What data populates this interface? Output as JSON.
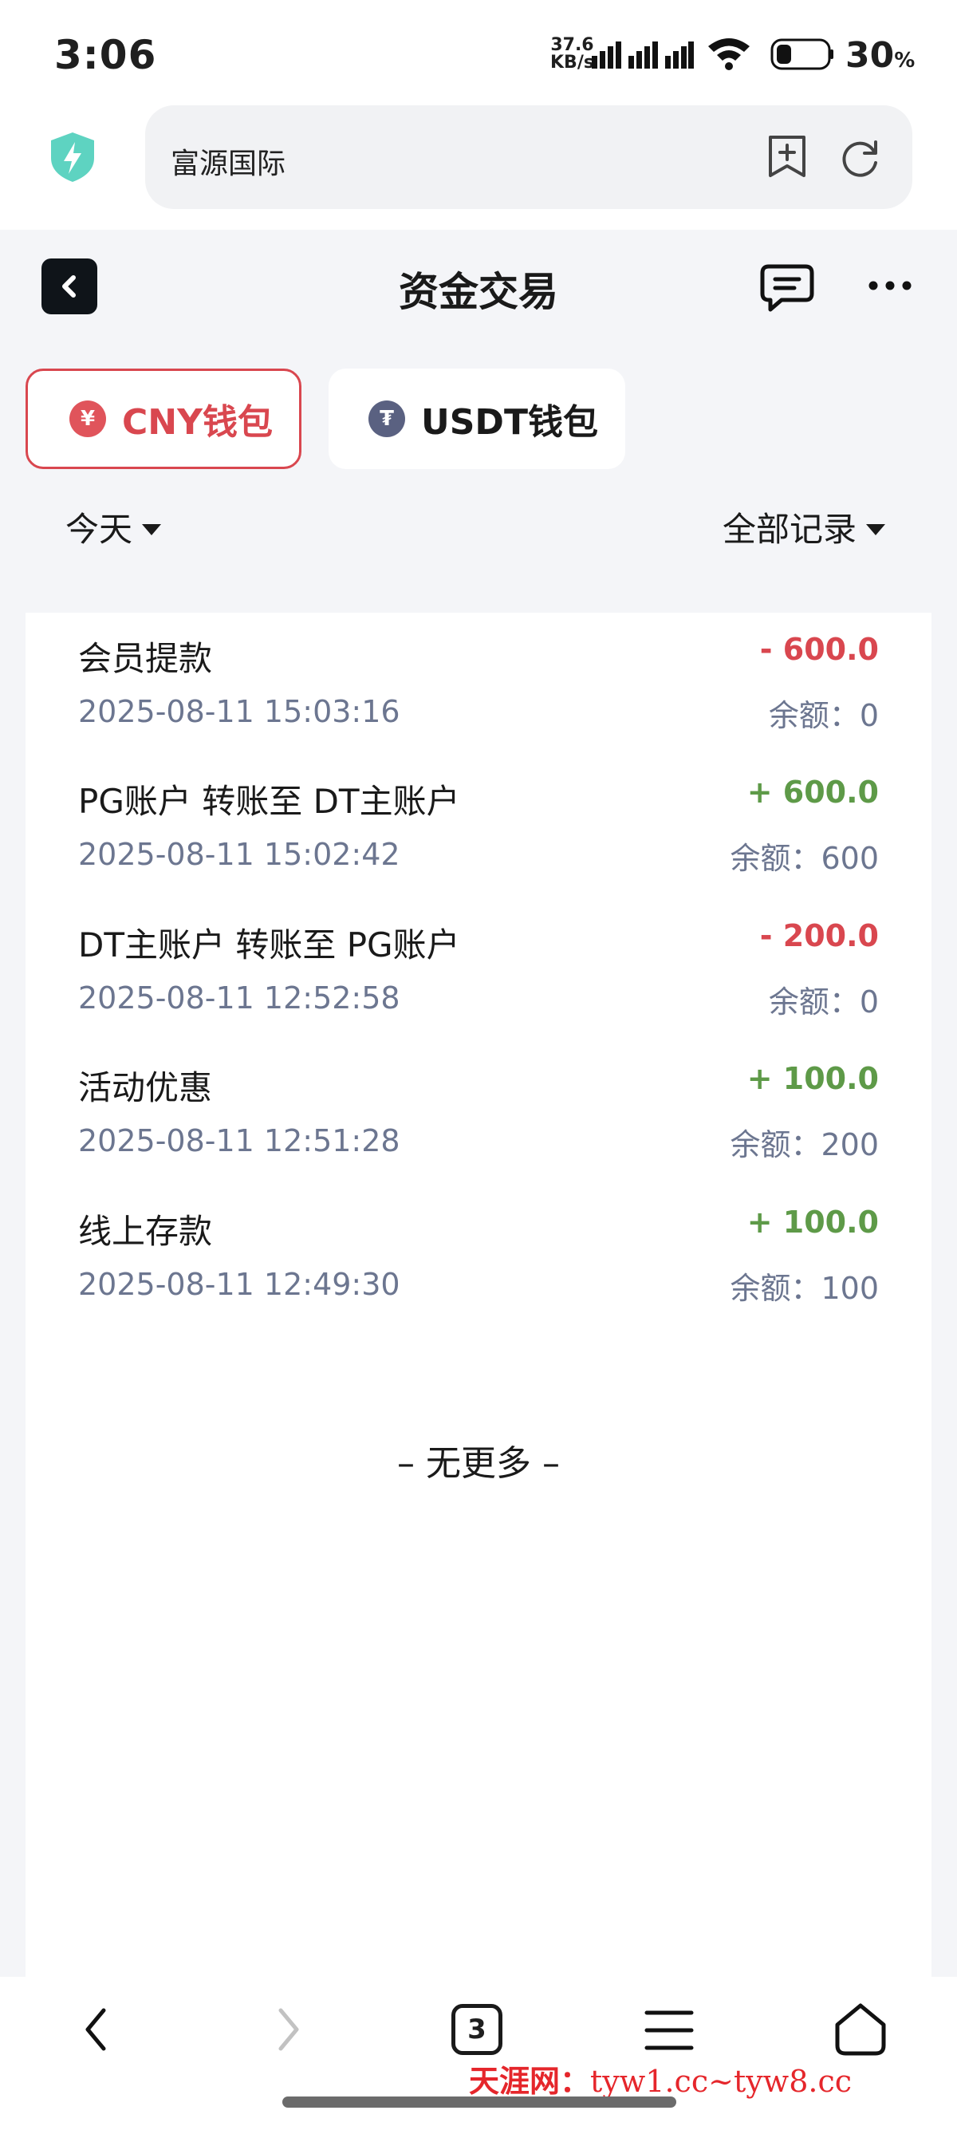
{
  "status_bar": {
    "time": "3:06",
    "net_speed_value": "37.6",
    "net_speed_unit": "KB/s",
    "battery_percent": "30",
    "battery_unit": "%",
    "battery_level": 0.3
  },
  "browser": {
    "url_text": "富源国际",
    "tab_count": "3"
  },
  "header": {
    "title": "资金交易"
  },
  "wallet_tabs": [
    {
      "label": "CNY钱包",
      "coin_symbol": "¥",
      "active": true
    },
    {
      "label": "USDT钱包",
      "coin_symbol": "₮",
      "active": false
    }
  ],
  "filters": {
    "date": "今天",
    "record_type": "全部记录"
  },
  "transactions": [
    {
      "title": "会员提款",
      "time": "2025-08-11 15:03:16",
      "amount": "- 600.0",
      "balance": "余额：0",
      "direction": "out"
    },
    {
      "title": "PG账户 转账至 DT主账户",
      "time": "2025-08-11 15:02:42",
      "amount": "+ 600.0",
      "balance": "余额：600",
      "direction": "in"
    },
    {
      "title": "DT主账户 转账至 PG账户",
      "time": "2025-08-11 12:52:58",
      "amount": "- 200.0",
      "balance": "余额：0",
      "direction": "out"
    },
    {
      "title": "活动优惠",
      "time": "2025-08-11 12:51:28",
      "amount": "+ 100.0",
      "balance": "余额：200",
      "direction": "in"
    },
    {
      "title": "线上存款",
      "time": "2025-08-11 12:49:30",
      "amount": "+ 100.0",
      "balance": "余额：100",
      "direction": "in"
    }
  ],
  "list_footer": "– 无更多 –",
  "watermark": {
    "name": "天涯网：",
    "urls": "tyw1.cc~tyw8.cc"
  },
  "colors": {
    "accent_red": "#d9474f",
    "positive_green": "#5e9a48",
    "muted_text": "#6c7690",
    "page_bg": "#f4f5f8"
  },
  "icons": [
    "shield-icon",
    "bookmark-add-icon",
    "reload-icon",
    "chevron-left-icon",
    "chat-icon",
    "more-icon",
    "chevron-down-icon",
    "back-icon",
    "forward-icon",
    "menu-icon",
    "home-icon"
  ]
}
